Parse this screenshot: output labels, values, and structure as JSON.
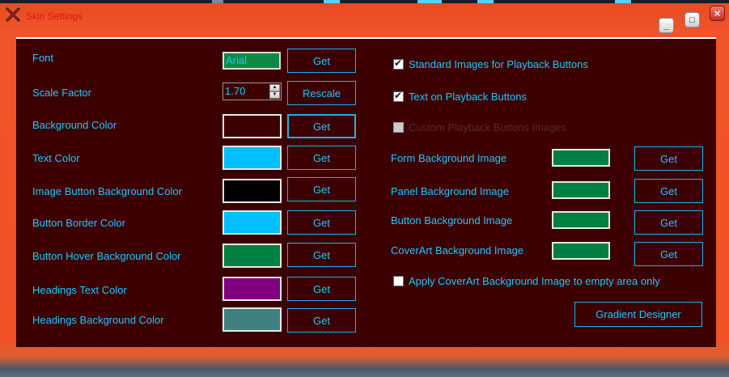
{
  "window": {
    "title": "Skin Settings",
    "minimize_glyph": "_",
    "maximize_glyph": "□",
    "close_glyph": "✕"
  },
  "colors": {
    "panel_bg": "#3c0000",
    "text": "#1ec8ff",
    "border": "#18b4ec",
    "frame": "#ef5227"
  },
  "left": {
    "font": {
      "label": "Font",
      "value": "Arial",
      "button": "Get"
    },
    "scale": {
      "label": "Scale Factor",
      "value": "1.70",
      "button": "Rescale"
    },
    "rows": [
      {
        "label": "Background Color",
        "color": "#3c0000",
        "button": "Get"
      },
      {
        "label": "Text Color",
        "color": "#00bfff",
        "button": "Get"
      },
      {
        "label": "Image Button Background Color",
        "color": "#000000",
        "button": "Get"
      },
      {
        "label": "Button Border Color",
        "color": "#00bfff",
        "button": "Get"
      },
      {
        "label": "Button Hover Background Color",
        "color": "#008040",
        "button": "Get"
      },
      {
        "label": "Headings Text Color",
        "color": "#800080",
        "button": "Get"
      },
      {
        "label": "Headings Background Color",
        "color": "#408080",
        "button": "Get"
      }
    ]
  },
  "right": {
    "checkboxes": [
      {
        "label": "Standard Images for Playback Buttons",
        "checked": true,
        "enabled": true
      },
      {
        "label": "Text on Playback Buttons",
        "checked": true,
        "enabled": true
      },
      {
        "label": "Custom Playback Buttons Images",
        "checked": false,
        "enabled": false
      }
    ],
    "images": [
      {
        "label": "Form Background Image",
        "color": "#008040",
        "button": "Get"
      },
      {
        "label": "Panel Background Image",
        "color": "#008040",
        "button": "Get"
      },
      {
        "label": "Button Background Image",
        "color": "#008040",
        "button": "Get"
      },
      {
        "label": "CoverArt Background Image",
        "color": "#008040",
        "button": "Get"
      }
    ],
    "apply_empty": {
      "label": "Apply CoverArt Background Image to empty area only",
      "checked": false
    },
    "gradient_button": "Gradient Designer"
  }
}
